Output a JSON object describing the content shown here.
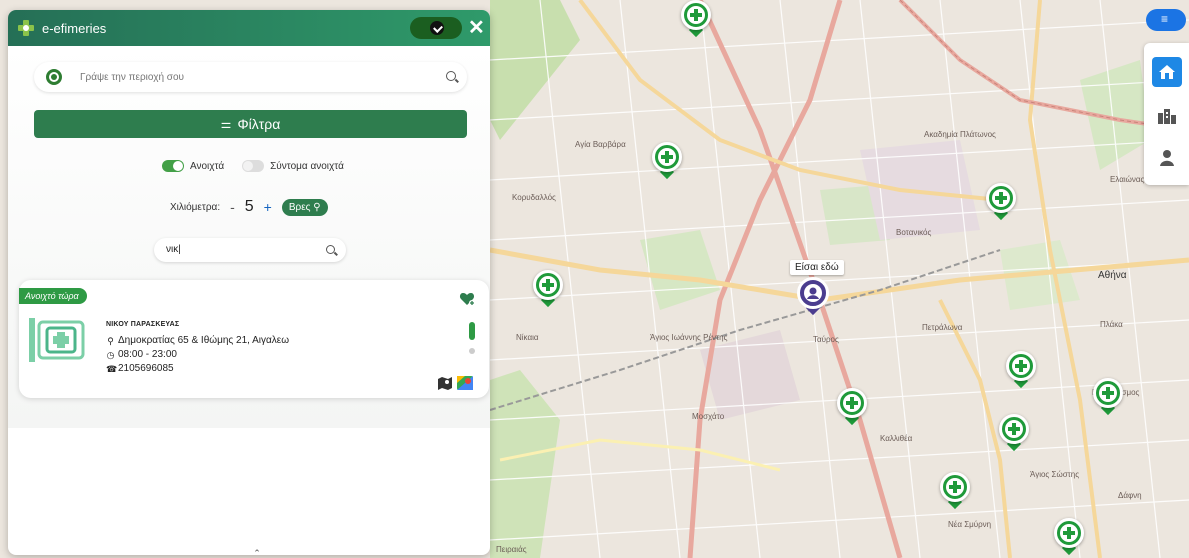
{
  "app": {
    "title": "e-efimeries"
  },
  "search": {
    "placeholder": "Γράψε την περιοχή σου"
  },
  "filter": {
    "label": "Φίλτρα"
  },
  "toggles": {
    "open": "Ανοιχτά",
    "soon": "Σύντομα ανοιχτά",
    "open_on": true,
    "soon_on": false
  },
  "distance": {
    "label": "Χιλιόμετρα:",
    "minus": "-",
    "value": "5",
    "plus": "+",
    "find": "Βρες"
  },
  "name_search": {
    "value": "νικ|"
  },
  "result": {
    "badge": "Ανοιχτό τώρα",
    "name": "ΝΙΚΟΥ ΠΑΡΑΣΚΕΥΑΣ",
    "address": "Δημοκρατίας 65 & Ιθώμης 21, Αιγαλεω",
    "hours": "08:00 - 23:00",
    "phone": "2105696085"
  },
  "map": {
    "you_are_here": "Είσαι εδώ",
    "labels": [
      "Αγία Βαρβάρα",
      "Κορυδαλλός",
      "Νίκαια",
      "Άγιος Ιωάννης Ρέντης",
      "Αθήνα",
      "Καλλιθέα",
      "Νέος Κόσμος",
      "Μοσχάτο",
      "Πειραιάς",
      "Ταύρος",
      "Πετράλωνα",
      "Ακαδημία Πλάτωνος",
      "Βοτανικός",
      "Ελαιώνας",
      "Πλάκα",
      "Άγιος Σώστης",
      "Δάφνη",
      "Νέα Σμύρνη"
    ]
  },
  "colors": {
    "brand_green": "#2e7d4e",
    "pin_green": "#1f9a3a",
    "you_pin": "#4b3d8f",
    "accent_blue": "#1e88e5"
  }
}
